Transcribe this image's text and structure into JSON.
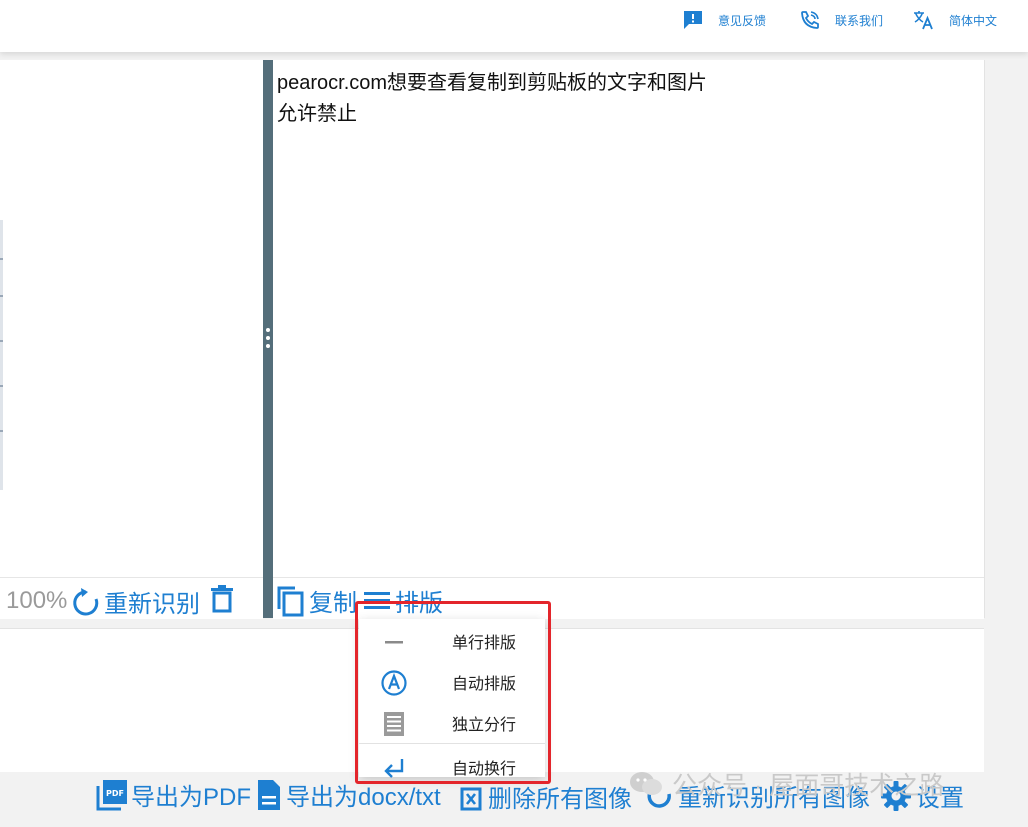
{
  "header": {
    "feedback": {
      "label": "意见反馈",
      "icon": "feedback-icon"
    },
    "contact": {
      "label": "联系我们",
      "icon": "phone-icon"
    },
    "language": {
      "label": "简体中文",
      "icon": "translate-icon"
    }
  },
  "ocr_result": {
    "lines": [
      "pearocr.com想要查看复制到剪贴板的文字和图片",
      "允许禁止"
    ]
  },
  "image_toolbar": {
    "zoom": "100%",
    "recognize_again": "重新识别",
    "delete_icon": "trash-icon"
  },
  "text_toolbar": {
    "copy": "复制",
    "layout": "排版"
  },
  "layout_menu": {
    "items": [
      {
        "label": "单行排版",
        "icon": "single-line-icon"
      },
      {
        "label": "自动排版",
        "icon": "auto-a-icon"
      },
      {
        "label": "独立分行",
        "icon": "paragraph-icon"
      },
      {
        "label": "自动换行",
        "icon": "wrap-icon"
      }
    ]
  },
  "bottom_toolbar": {
    "export_pdf": "导出为PDF",
    "export_docx": "导出为docx/txt",
    "delete_all": "删除所有图像",
    "recognize_all": "重新识别所有图像",
    "settings": "设置"
  },
  "watermark": {
    "text": "公众号 · 屋面哥技术之路"
  },
  "colors": {
    "accent": "#1e7fd1",
    "splitter": "#546e7a",
    "highlight": "#e3252b"
  }
}
